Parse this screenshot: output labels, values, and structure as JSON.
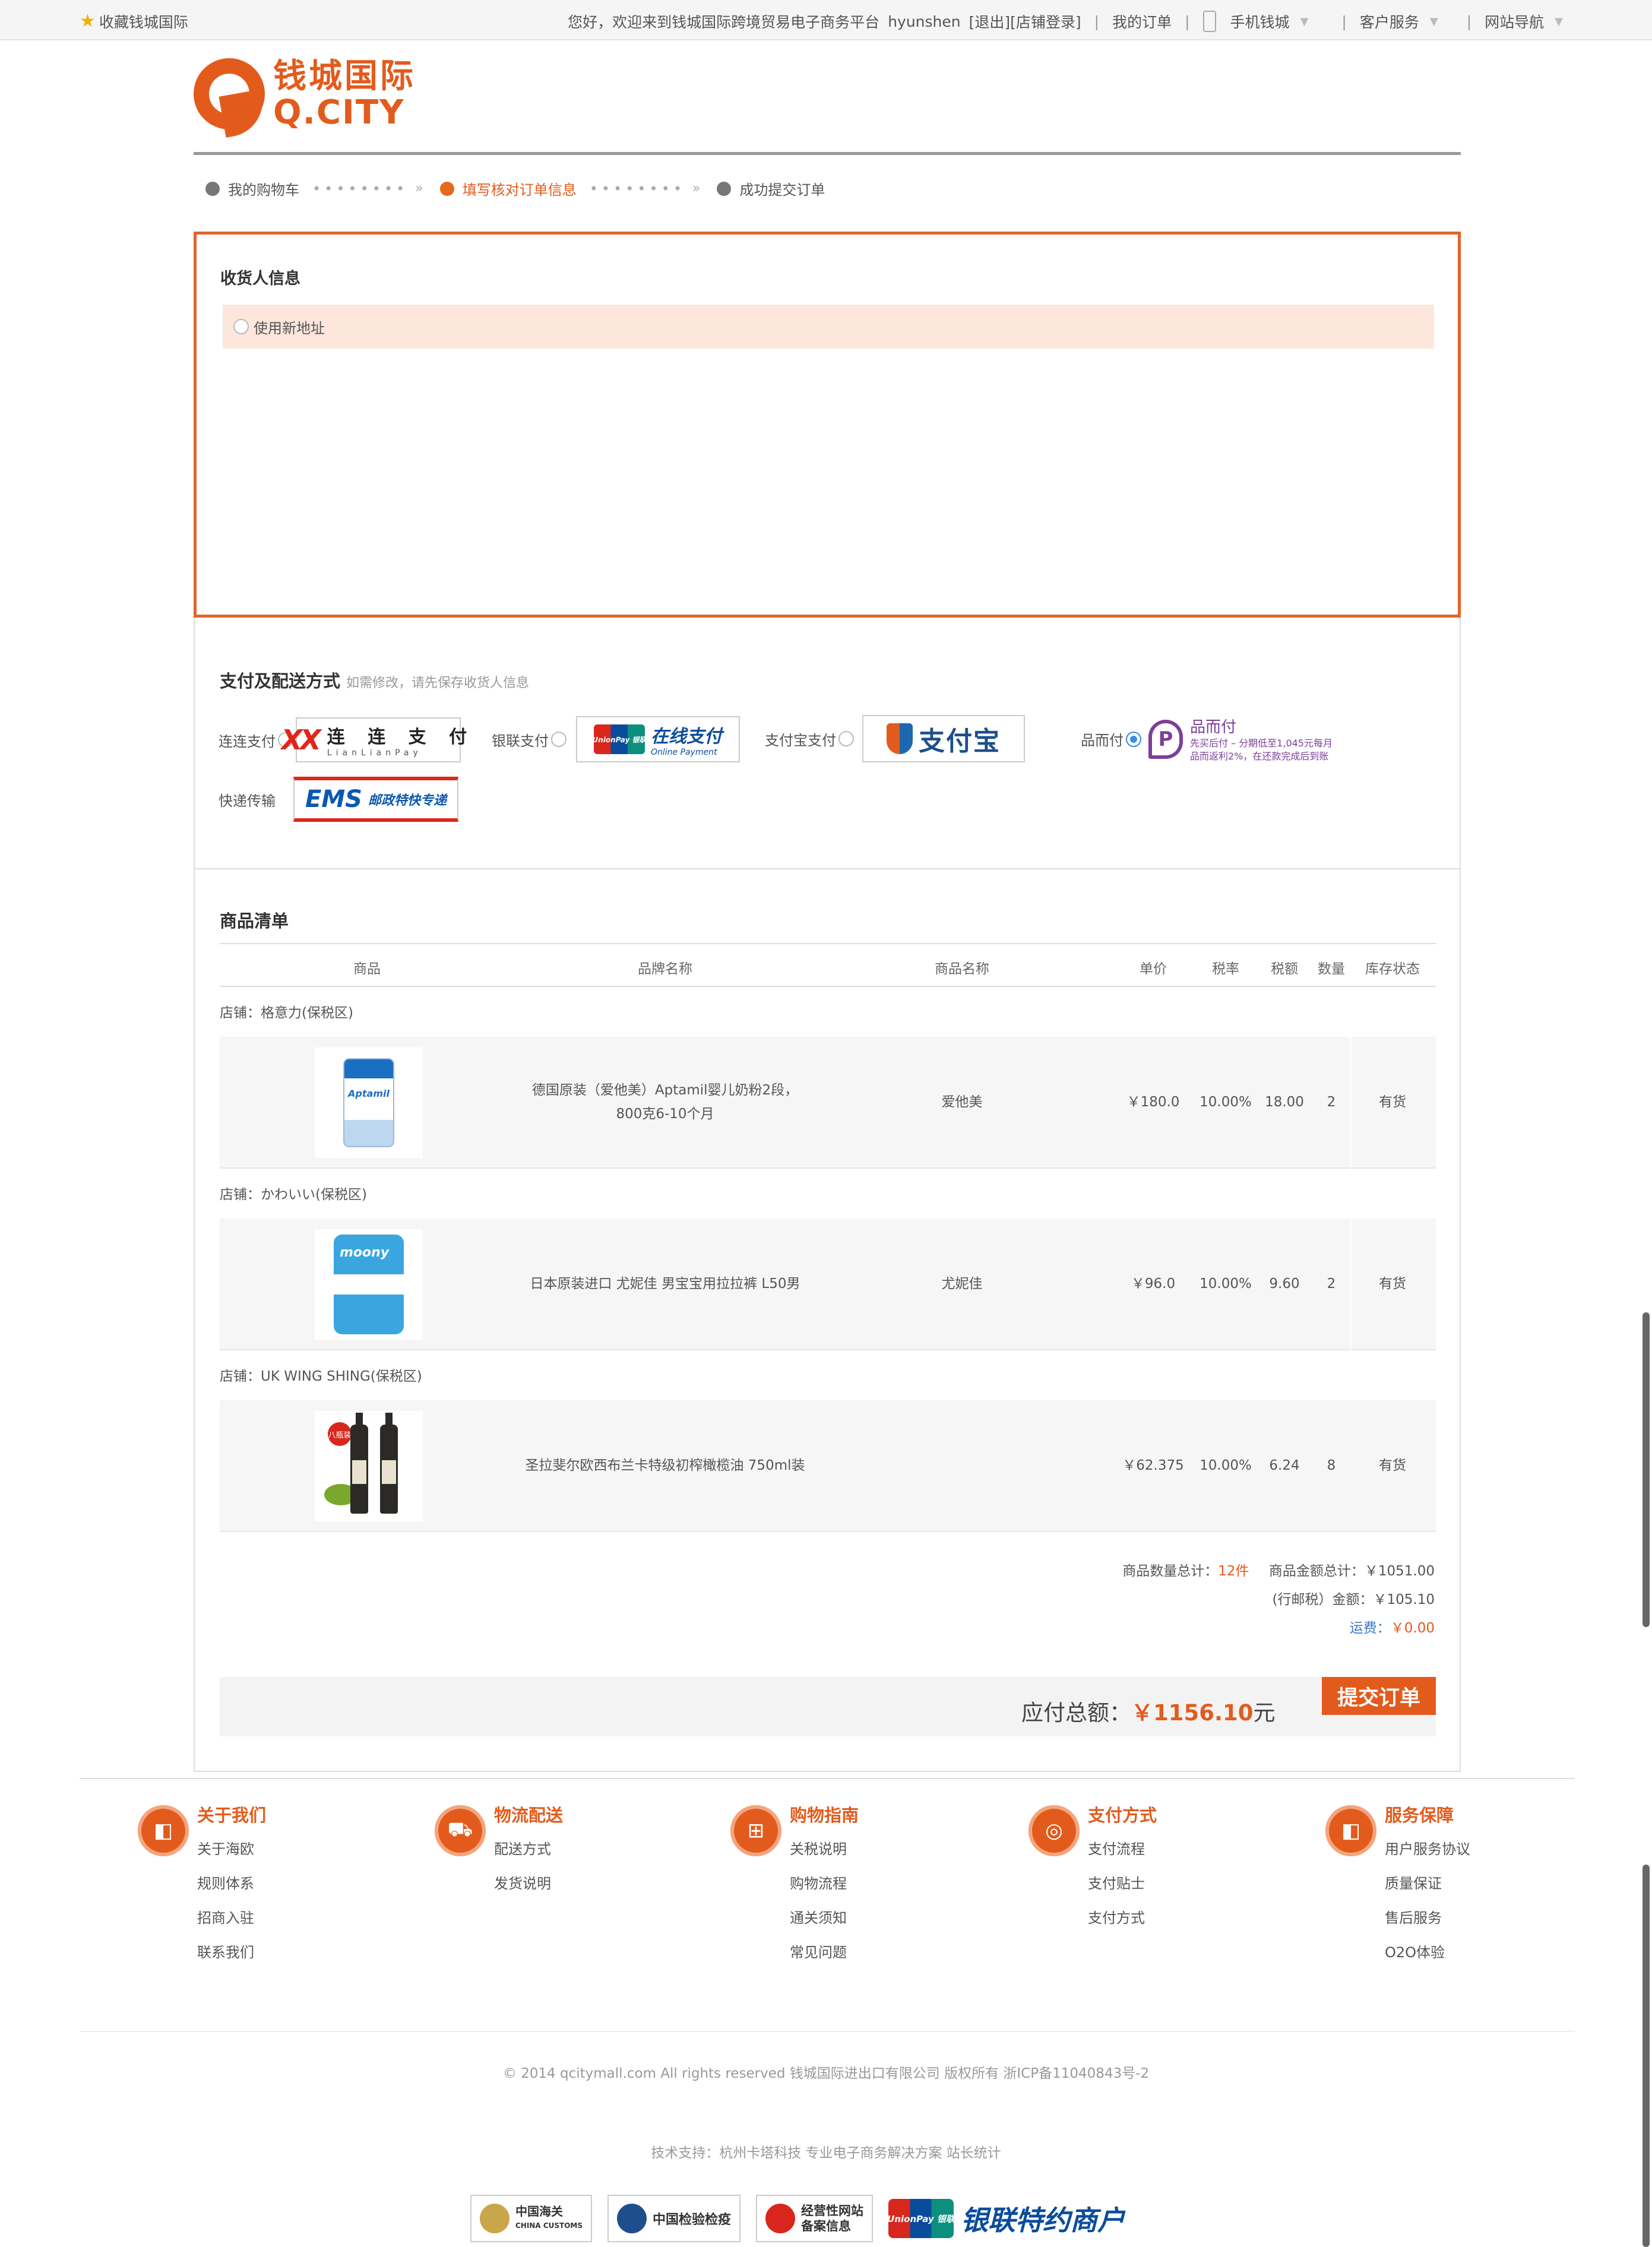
{
  "topbar": {
    "favorite": "收藏钱城国际",
    "welcome": "您好，欢迎来到钱城国际跨境贸易电子商务平台",
    "username": "hyunshen",
    "logout": "[退出]",
    "shop_login": "[店铺登录]",
    "my_orders": "我的订单",
    "mobile": "手机钱城",
    "service": "客户服务",
    "site_nav": "网站导航"
  },
  "logo": {
    "cn": "钱城国际",
    "en": "Q.CITY"
  },
  "steps": [
    "我的购物车",
    "填写核对订单信息",
    "成功提交订单"
  ],
  "consignee": {
    "title": "收货人信息",
    "new_address": "使用新地址"
  },
  "payment": {
    "title": "支付及配送方式",
    "hint": "如需修改，请先保存收货人信息",
    "options": [
      {
        "label": "连连支付",
        "badge_main": "连 连 支 付",
        "badge_sub": "LianLianPay"
      },
      {
        "label": "银联支付",
        "badge_main": "在线支付",
        "badge_sub": "Online Payment",
        "card": "UnionPay 银联"
      },
      {
        "label": "支付宝支付",
        "badge_main": "支付宝"
      },
      {
        "label": "品而付",
        "badge_main": "品而付",
        "badge_line1": "先买后付 – 分期低至1,045元每月",
        "badge_line2": "品而返利2%，在还款完成后到账"
      }
    ],
    "shipping_label": "快递传输",
    "shipping_badge_main": "EMS",
    "shipping_badge_sub": "邮政特快专递"
  },
  "products": {
    "title": "商品清单",
    "headers": [
      "商品",
      "品牌名称",
      "商品名称",
      "单价",
      "税率",
      "税额",
      "数量",
      "库存状态"
    ],
    "groups": [
      {
        "shop": "店铺：格意力(保税区)",
        "image": "Aptamil",
        "name_line1": "德国原装（爱他美）Aptamil婴儿奶粉2段，",
        "name_line2": "800克6-10个月",
        "brand": "爱他美",
        "price": "￥180.0",
        "tax_rate": "10.00%",
        "tax": "18.00",
        "qty": "2",
        "stock": "有货"
      },
      {
        "shop": "店铺：かわいい(保税区)",
        "image": "moony",
        "name_line1": "日本原装进口 尤妮佳 男宝宝用拉拉裤 L50男",
        "name_line2": "",
        "brand": "尤妮佳",
        "price": "￥96.0",
        "tax_rate": "10.00%",
        "tax": "9.60",
        "qty": "2",
        "stock": "有货"
      },
      {
        "shop": "店铺：UK WING SHING(保税区)",
        "image": "八瓶装",
        "name_line1": "圣拉斐尔欧西布兰卡特级初榨橄榄油 750ml装",
        "name_line2": "",
        "brand": "",
        "price": "￥62.375",
        "tax_rate": "10.00%",
        "tax": "6.24",
        "qty": "8",
        "stock": "有货"
      }
    ]
  },
  "totals": {
    "count_label": "商品数量总计：",
    "count": "12件",
    "amount_label": "商品金额总计：",
    "amount": "￥1051.00",
    "tax_label": "(行邮税）金额：",
    "tax": "￥105.10",
    "freight_label": "运费：",
    "freight": "￥0.00"
  },
  "payable": {
    "label": "应付总额：",
    "amount": "￥1156.10",
    "unit": "元",
    "submit": "提交订单"
  },
  "footer": {
    "columns": [
      {
        "title": "关于我们",
        "links": [
          "关于海欧",
          "规则体系",
          "招商入驻",
          "联系我们"
        ]
      },
      {
        "title": "物流配送",
        "links": [
          "配送方式",
          "发货说明"
        ]
      },
      {
        "title": "购物指南",
        "links": [
          "关税说明",
          "购物流程",
          "通关须知",
          "常见问题"
        ]
      },
      {
        "title": "支付方式",
        "links": [
          "支付流程",
          "支付贴士",
          "支付方式"
        ]
      },
      {
        "title": "服务保障",
        "links": [
          "用户服务协议",
          "质量保证",
          "售后服务",
          "O2O体验"
        ]
      }
    ],
    "copyright": "© 2014 qcitymall.com All rights reserved 钱城国际进出口有限公司 版权所有 浙ICP备11040843号-2",
    "tech": "技术支持：杭州卡塔科技 专业电子商务解决方案 站长统计",
    "certs": [
      "中国海关",
      "CHINA CUSTOMS",
      "中国检验检疫",
      "经营性网站",
      "备案信息",
      "UnionPay 银联",
      "银联特约商户"
    ]
  },
  "colors": {
    "accent": "#e35b1c",
    "link_blue": "#3a7bc8"
  }
}
